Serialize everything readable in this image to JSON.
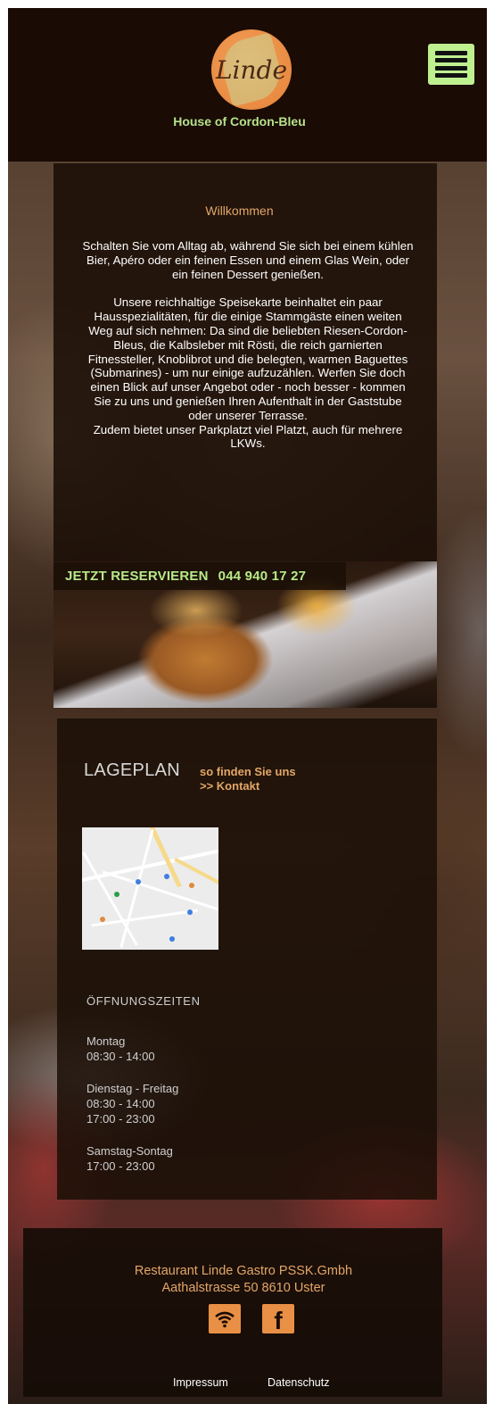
{
  "header": {
    "logo_text": "Linde",
    "tagline": "House of Cordon-Bleu",
    "menu_icon": "hamburger-menu-icon",
    "accent_color": "#bff090"
  },
  "welcome": {
    "title": "Willkommen",
    "paragraphs": [
      "Schalten Sie vom Alltag ab, während Sie sich bei einem kühlen Bier, Apéro oder ein feinen Essen und einem Glas Wein, oder ein feinen Dessert genießen.",
      "Unsere reichhaltige Speisekarte beinhaltet ein paar Hausspezialitäten, für die einige Stammgäste einen weiten Weg auf sich nehmen: Da sind die beliebten Riesen-Cordon-Bleus, die Kalbsleber mit Rösti, die reich garnierten Fitnessteller, Knoblibrot und die belegten, warmen Baguettes (Submarines) - um nur einige aufzuzählen. Werfen Sie doch einen Blick auf unser Angebot oder - noch besser - kommen Sie zu uns und genießen Ihren Aufenthalt in der Gaststube oder unserer Terrasse.",
      "Zudem bietet unser Parkplatzt viel Platzt, auch für mehrere  LKWs."
    ]
  },
  "reservation": {
    "label": "JETZT RESERVIEREN",
    "phone": "044 940 17 27"
  },
  "location": {
    "title": "LAGEPLAN",
    "subtitle": "so finden Sie uns",
    "contact_link": ">> Kontakt"
  },
  "hours": {
    "title": "ÖFFNUNGSZEITEN",
    "blocks": [
      {
        "day": "Montag",
        "times": [
          "08:30 - 14:00"
        ]
      },
      {
        "day": "Dienstag - Freitag",
        "times": [
          "08:30 - 14:00",
          "17:00 - 23:00"
        ]
      },
      {
        "day": "Samstag-Sontag",
        "times": [
          "17:00 - 23:00"
        ]
      }
    ]
  },
  "footer": {
    "company": "Restaurant Linde Gastro PSSK.Gmbh",
    "address": "Aathalstrasse 50 8610 Uster",
    "icons": [
      "wifi-icon",
      "facebook-icon"
    ],
    "fb_glyph": "f",
    "links": [
      "Impressum",
      "Datenschutz"
    ]
  },
  "colors": {
    "header_bg": "#1a0b05",
    "orange": "#e3a768",
    "green": "#b8ea88"
  }
}
